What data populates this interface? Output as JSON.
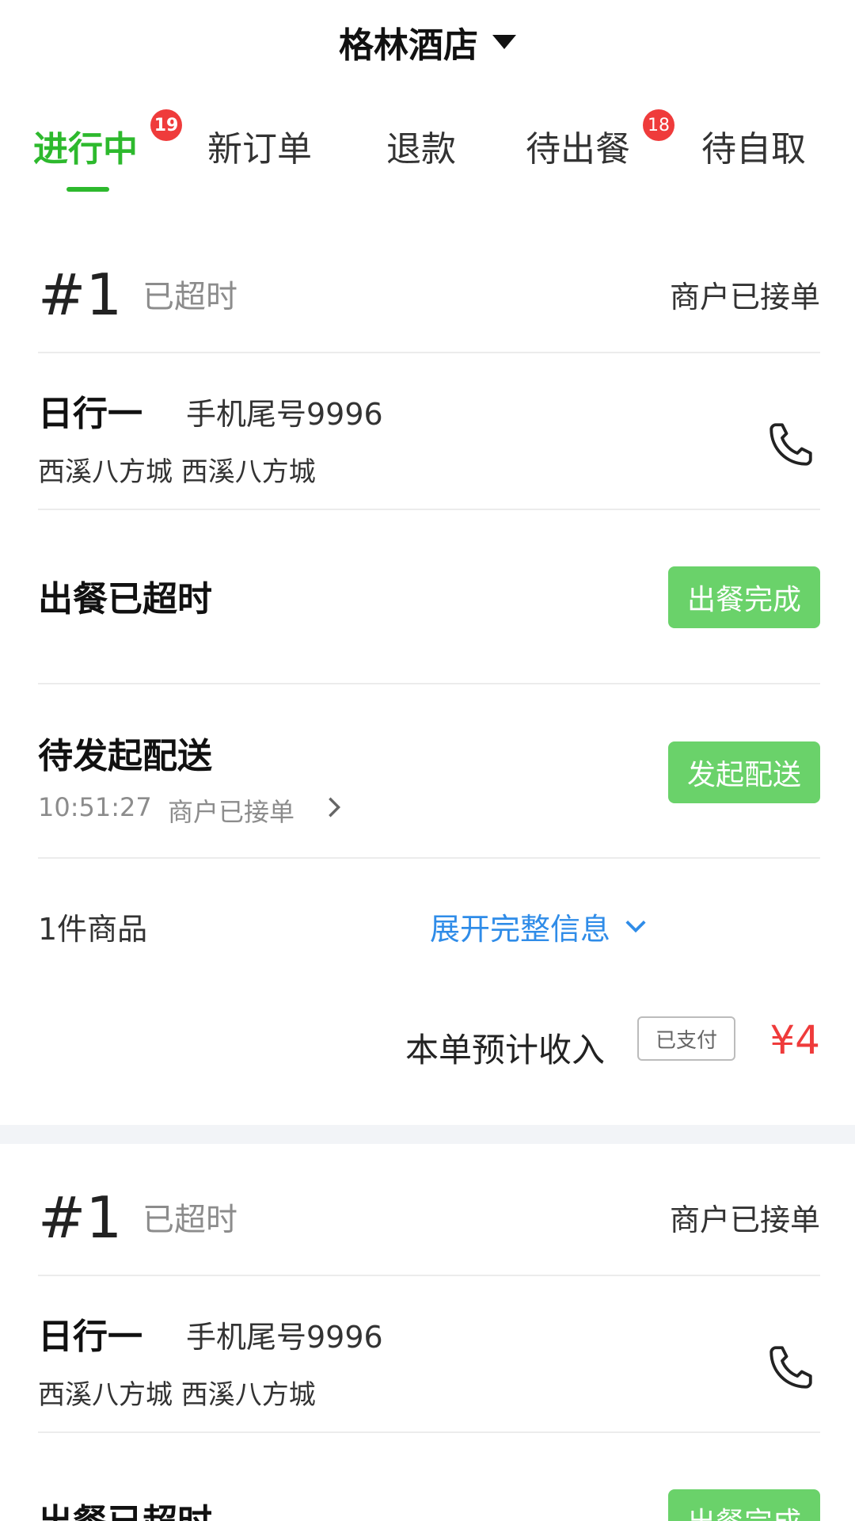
{
  "header": {
    "store_name": "格林酒店"
  },
  "tabs": [
    {
      "label": "进行中",
      "badge": "19",
      "active": true
    },
    {
      "label": "新订单",
      "badge": "",
      "active": false
    },
    {
      "label": "退款",
      "badge": "",
      "active": false
    },
    {
      "label": "待出餐",
      "badge": "18",
      "active": false
    },
    {
      "label": "待自取",
      "badge": "",
      "active": false
    }
  ],
  "orders": [
    {
      "number": "#1",
      "overdue_text": "已超时",
      "merchant_status": "商户已接单",
      "customer_name": "日行一",
      "phone_tail": "手机尾号9996",
      "address": "西溪八方城 西溪八方城",
      "meal_status": "出餐已超时",
      "meal_button": "出餐完成",
      "delivery_status_title": "待发起配送",
      "delivery_time": "10:51:27",
      "delivery_detail": "商户已接单",
      "delivery_button": "发起配送",
      "item_count": "1件商品",
      "expand_label": "展开完整信息",
      "income_label": "本单预计收入",
      "paid_label": "已支付",
      "income_amount": "¥4"
    },
    {
      "number": "#1",
      "overdue_text": "已超时",
      "merchant_status": "商户已接单",
      "customer_name": "日行一",
      "phone_tail": "手机尾号9996",
      "address": "西溪八方城 西溪八方城",
      "meal_status": "出餐已超时",
      "meal_button": "出餐完成"
    }
  ],
  "colors": {
    "accent_green": "#2db92d",
    "button_green": "#6ad26a",
    "badge_red": "#ef3b3b",
    "link_blue": "#2f8ce8"
  }
}
